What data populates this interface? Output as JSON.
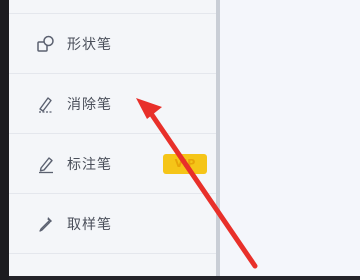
{
  "menu": {
    "items": [
      {
        "label": "形状笔",
        "icon": "shape-icon"
      },
      {
        "label": "消除笔",
        "icon": "eraser-pen-icon"
      },
      {
        "label": "标注笔",
        "icon": "annotate-pen-icon",
        "badge": "VIP"
      },
      {
        "label": "取样笔",
        "icon": "eyedropper-icon"
      }
    ]
  },
  "colors": {
    "accent_arrow": "#e8302a",
    "vip_badge": "#f5c518",
    "panel_bg": "#f4f6f9",
    "text": "#4a4f5a"
  }
}
